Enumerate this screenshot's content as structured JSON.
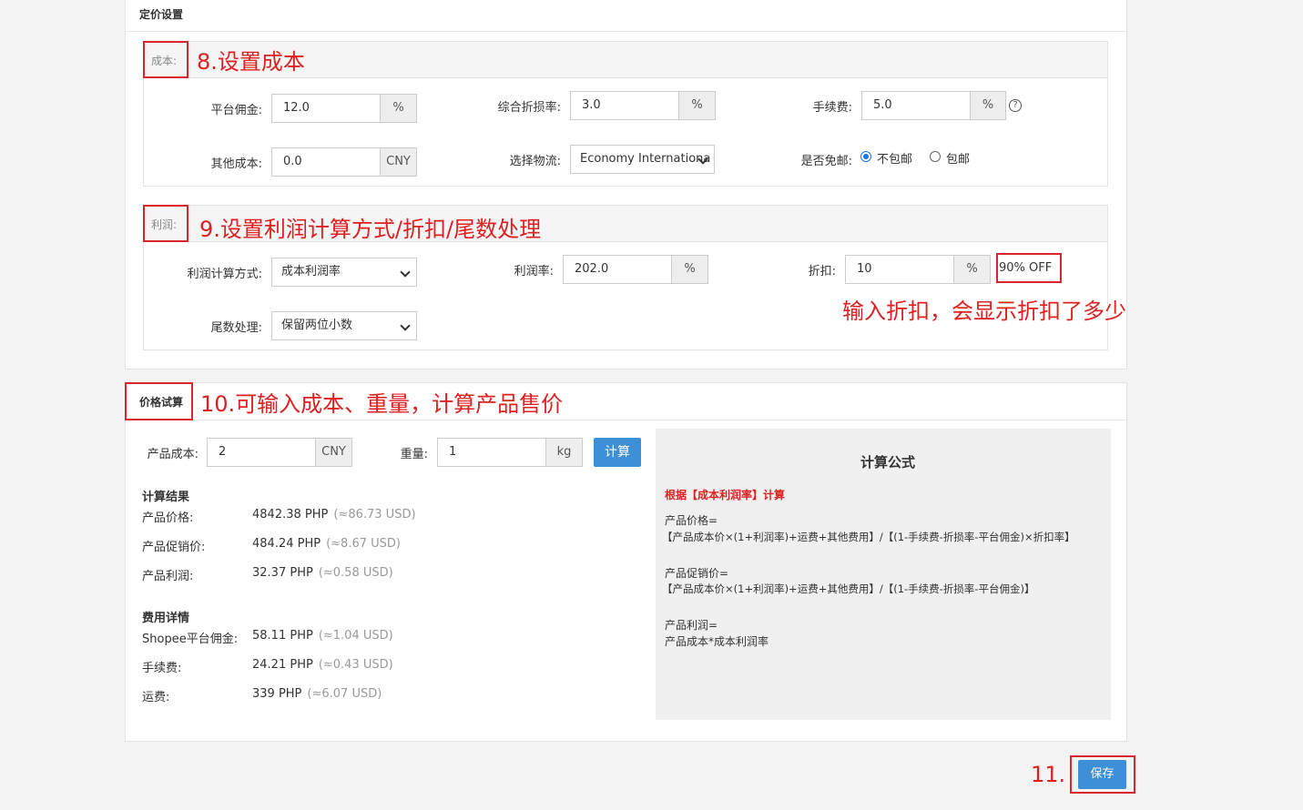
{
  "pricing": {
    "title": "定价设置",
    "cost_section": {
      "tag": "成本:",
      "note": "8.设置成本",
      "platform_commission": {
        "label": "平台佣金:",
        "value": "12.0",
        "unit": "%"
      },
      "combined_discount_loss": {
        "label": "综合折损率:",
        "value": "3.0",
        "unit": "%"
      },
      "handling_fee": {
        "label": "手续费:",
        "value": "5.0",
        "unit": "%"
      },
      "other_cost": {
        "label": "其他成本:",
        "value": "0.0",
        "unit": "CNY"
      },
      "logistics": {
        "label": "选择物流:",
        "value": "Economy Internationa"
      },
      "free_shipping": {
        "label": "是否免邮:",
        "options": [
          "不包邮",
          "包邮"
        ],
        "selected": "不包邮"
      }
    },
    "profit_section": {
      "tag": "利润:",
      "note": "9.设置利润计算方式/折扣/尾数处理",
      "method": {
        "label": "利润计算方式:",
        "value": "成本利润率"
      },
      "profit_rate": {
        "label": "利润率:",
        "value": "202.0",
        "unit": "%"
      },
      "discount": {
        "label": "折扣:",
        "value": "10",
        "unit": "%",
        "result": "90% OFF"
      },
      "rounding": {
        "label": "尾数处理:",
        "value": "保留两位小数"
      },
      "discount_note": "输入折扣，会显示折扣了多少"
    }
  },
  "trial": {
    "title": "价格试算",
    "note": "10.可输入成本、重量，计算产品售价",
    "cost": {
      "label": "产品成本:",
      "value": "2",
      "unit": "CNY"
    },
    "weight": {
      "label": "重量:",
      "value": "1",
      "unit": "kg"
    },
    "calc_button": "计算",
    "results_title": "计算结果",
    "results": [
      {
        "label": "产品价格:",
        "value": "4842.38 PHP",
        "usd": "(≈86.73 USD)"
      },
      {
        "label": "产品促销价:",
        "value": "484.24 PHP",
        "usd": "(≈8.67 USD)"
      },
      {
        "label": "产品利润:",
        "value": "32.37 PHP",
        "usd": "(≈0.58 USD)"
      }
    ],
    "fees_title": "费用详情",
    "fees": [
      {
        "label": "Shopee平台佣金:",
        "value": "58.11 PHP",
        "usd": "(≈1.04 USD)"
      },
      {
        "label": "手续费:",
        "value": "24.21 PHP",
        "usd": "(≈0.43 USD)"
      },
      {
        "label": "运费:",
        "value": "339 PHP",
        "usd": "(≈6.07 USD)"
      }
    ],
    "formula": {
      "title": "计算公式",
      "basis": "根据【成本利润率】计算",
      "price_label": "产品价格=",
      "price_expr": "【产品成本价×(1+利润率)+运费+其他费用】/【(1-手续费-折损率-平台佣金)×折扣率】",
      "promo_label": "产品促销价=",
      "promo_expr": "【产品成本价×(1+利润率)+运费+其他费用】/【(1-手续费-折损率-平台佣金)】",
      "profit_label": "产品利润=",
      "profit_expr": "产品成本*成本利润率"
    }
  },
  "save": {
    "note": "11.",
    "label": "保存"
  },
  "colors": {
    "accent": "#3d8fd6",
    "annotation": "#d9262b"
  }
}
